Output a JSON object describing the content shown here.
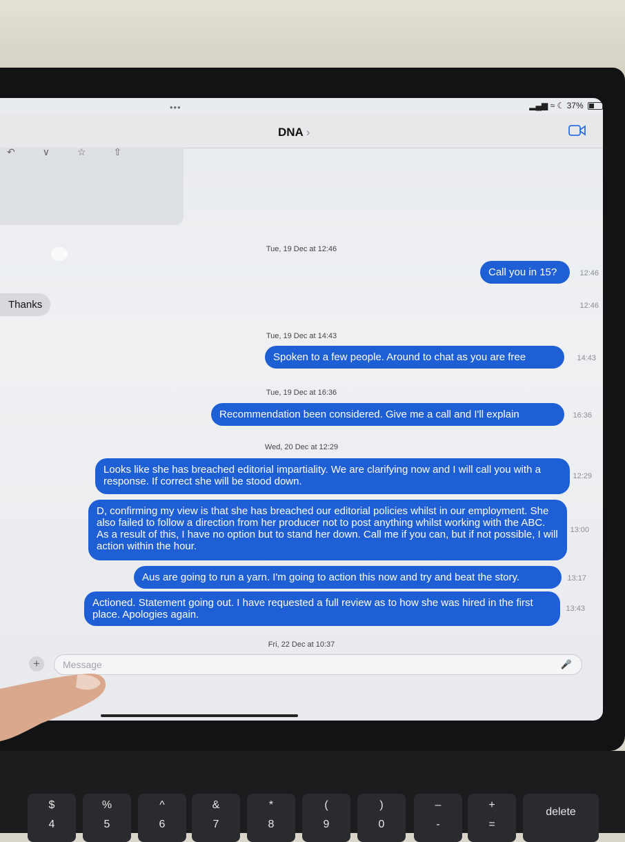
{
  "status": {
    "signal": "•••",
    "battery_text": "37%"
  },
  "nav": {
    "contact": "DNA",
    "chevron": "›"
  },
  "messages": [
    {
      "kind": "timestamp",
      "text": "Tue, 19 Dec at 12:46"
    },
    {
      "kind": "sent",
      "text": "Call you in 15?",
      "time": "12:46"
    },
    {
      "kind": "received",
      "text": "Thanks",
      "time": "12:46"
    },
    {
      "kind": "timestamp",
      "text": "Tue, 19 Dec at 14:43"
    },
    {
      "kind": "sent",
      "text": "Spoken to a few people. Around to chat as you are free",
      "time": "14:43"
    },
    {
      "kind": "timestamp",
      "text": "Tue, 19 Dec at 16:36"
    },
    {
      "kind": "sent",
      "text": "Recommendation been considered. Give me a call and I'll explain",
      "time": "16:36"
    },
    {
      "kind": "timestamp",
      "text": "Wed, 20 Dec at 12:29"
    },
    {
      "kind": "sent",
      "text": "Looks like she has breached editorial impartiality. We are clarifying now and I will call you with a response. If correct she will be stood down.",
      "time": "12:29"
    },
    {
      "kind": "sent",
      "text": "D, confirming my view is that she has breached our editorial policies whilst in our employment. She also failed to follow a direction from her producer not to post anything whilst working with the ABC. As a result of this, I have no option but to stand her down. Call me if you can, but if not possible, I will action within the hour.",
      "time": "13:00"
    },
    {
      "kind": "sent",
      "text": "Aus are going to run a yarn. I'm going to action this now and try and beat the story.",
      "time": "13:17"
    },
    {
      "kind": "sent",
      "text": "Actioned. Statement going out. I have requested a full review as to how she was hired in the first place. Apologies again.",
      "time": "13:43"
    },
    {
      "kind": "timestamp",
      "text": "Fri, 22 Dec at 10:37"
    }
  ],
  "composer": {
    "placeholder": "Message",
    "plus": "+"
  },
  "keys": [
    {
      "top": "$",
      "bottom": "4"
    },
    {
      "top": "%",
      "bottom": "5"
    },
    {
      "top": "^",
      "bottom": "6"
    },
    {
      "top": "&",
      "bottom": "7"
    },
    {
      "top": "*",
      "bottom": "8"
    },
    {
      "top": "(",
      "bottom": "9"
    },
    {
      "top": ")",
      "bottom": "0"
    },
    {
      "top": "–",
      "bottom": "-"
    },
    {
      "top": "+",
      "bottom": "="
    },
    {
      "top": "",
      "bottom": "delete"
    }
  ],
  "colors": {
    "sent_bubble": "#1f5fd6",
    "received_bubble": "#d7d9de",
    "accent": "#2f6fe0"
  }
}
